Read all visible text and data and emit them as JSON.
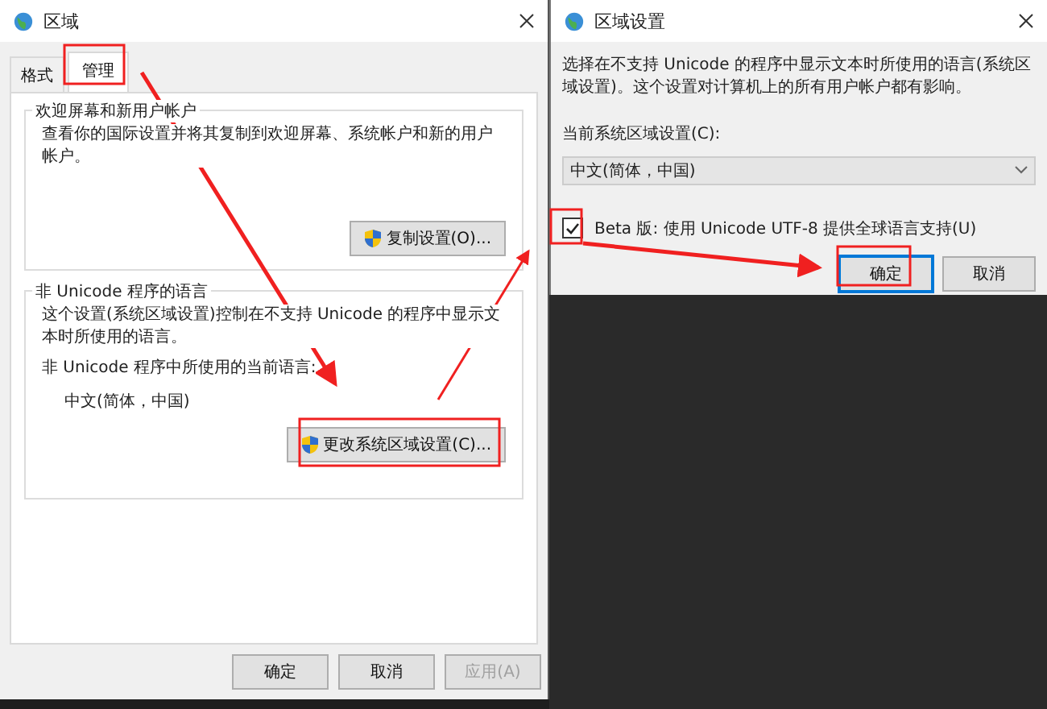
{
  "region_dialog": {
    "title": "区域",
    "tabs": [
      {
        "label": "格式",
        "selected": false
      },
      {
        "label": "管理",
        "selected": true
      }
    ],
    "groups": [
      {
        "title": "欢迎屏幕和新用户帐户",
        "description": "查看你的国际设置并将其复制到欢迎屏幕、系统帐户和新的用户帐户。",
        "button": "复制设置(O)..."
      },
      {
        "title": "非 Unicode 程序的语言",
        "description": "这个设置(系统区域设置)控制在不支持 Unicode 的程序中显示文本时所使用的语言。",
        "current_label": "非 Unicode 程序中所使用的当前语言:",
        "current_value": "中文(简体，中国)",
        "button": "更改系统区域设置(C)..."
      }
    ],
    "buttons": [
      {
        "label": "确定",
        "disabled": false
      },
      {
        "label": "取消",
        "disabled": false
      },
      {
        "label": "应用(A)",
        "disabled": true
      }
    ]
  },
  "locale_dialog": {
    "title": "区域设置",
    "description": "选择在不支持 Unicode 的程序中显示文本时所使用的语言(系统区域设置)。这个设置对计算机上的所有用户帐户都有影响。",
    "locale_label": "当前系统区域设置(C):",
    "locale_value": "中文(简体，中国)",
    "beta_option": {
      "label": "Beta 版: 使用 Unicode UTF-8 提供全球语言支持(U)",
      "checked": true
    },
    "buttons": [
      {
        "label": "确定",
        "focused": true
      },
      {
        "label": "取消",
        "focused": false
      }
    ]
  }
}
